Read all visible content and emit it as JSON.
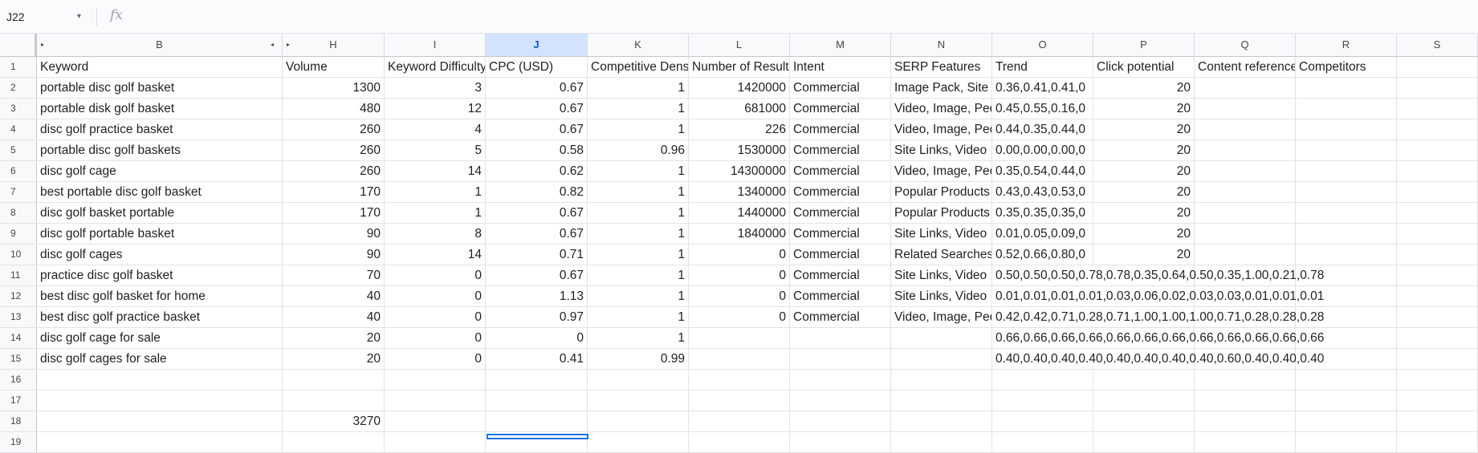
{
  "name_box": "J22",
  "name_box_arrow": "▾",
  "fx_label": "fx",
  "formula": "",
  "columns": [
    "B",
    "H",
    "I",
    "J",
    "K",
    "L",
    "M",
    "N",
    "O",
    "P",
    "Q",
    "R",
    "S"
  ],
  "selected_column": "J",
  "group_markers": {
    "left_b": "▸",
    "right_b": "◂",
    "left_h": "▸"
  },
  "rows": [
    {
      "n": "1",
      "cells": [
        "Keyword",
        "Volume",
        "Keyword Difficulty",
        "CPC (USD)",
        "Competitive Density",
        "Number of Results",
        "Intent",
        "SERP Features",
        "Trend",
        "Click potential",
        "Content references",
        "Competitors",
        ""
      ]
    },
    {
      "n": "2",
      "cells": [
        "portable disc golf basket",
        "1300",
        "3",
        "0.67",
        "1",
        "1420000",
        "Commercial",
        "Image Pack, Site Links",
        "0.36,0.41,0.41,0",
        "20",
        "",
        "",
        ""
      ]
    },
    {
      "n": "3",
      "cells": [
        "portable disk golf basket",
        "480",
        "12",
        "0.67",
        "1",
        "681000",
        "Commercial",
        "Video, Image, People",
        "0.45,0.55,0.16,0",
        "20",
        "",
        "",
        ""
      ]
    },
    {
      "n": "4",
      "cells": [
        "disc golf practice basket",
        "260",
        "4",
        "0.67",
        "1",
        "226",
        "Commercial",
        "Video, Image, People",
        "0.44,0.35,0.44,0",
        "20",
        "",
        "",
        ""
      ]
    },
    {
      "n": "5",
      "cells": [
        "portable disc golf baskets",
        "260",
        "5",
        "0.58",
        "0.96",
        "1530000",
        "Commercial",
        "Site Links, Video",
        "0.00,0.00,0.00,0",
        "20",
        "",
        "",
        ""
      ]
    },
    {
      "n": "6",
      "cells": [
        "disc golf cage",
        "260",
        "14",
        "0.62",
        "1",
        "14300000",
        "Commercial",
        "Video, Image, People",
        "0.35,0.54,0.44,0",
        "20",
        "",
        "",
        ""
      ]
    },
    {
      "n": "7",
      "cells": [
        "best portable disc golf basket",
        "170",
        "1",
        "0.82",
        "1",
        "1340000",
        "Commercial",
        "Popular Products",
        "0.43,0.43,0.53,0",
        "20",
        "",
        "",
        ""
      ]
    },
    {
      "n": "8",
      "cells": [
        "disc golf basket portable",
        "170",
        "1",
        "0.67",
        "1",
        "1440000",
        "Commercial",
        "Popular Products",
        "0.35,0.35,0.35,0",
        "20",
        "",
        "",
        ""
      ]
    },
    {
      "n": "9",
      "cells": [
        "disc golf portable basket",
        "90",
        "8",
        "0.67",
        "1",
        "1840000",
        "Commercial",
        "Site Links, Video",
        "0.01,0.05,0.09,0",
        "20",
        "",
        "",
        ""
      ]
    },
    {
      "n": "10",
      "cells": [
        "disc golf cages",
        "90",
        "14",
        "0.71",
        "1",
        "0",
        "Commercial",
        "Related Searches",
        "0.52,0.66,0.80,0",
        "20",
        "",
        "",
        ""
      ]
    },
    {
      "n": "11",
      "cells": [
        "practice disc golf basket",
        "70",
        "0",
        "0.67",
        "1",
        "0",
        "Commercial",
        "Site Links, Video",
        "0.50,0.50,0.50,0.78,0.78,0.35,0.64,0.50,0.35,1.00,0.21,0.78",
        "",
        "",
        "",
        ""
      ]
    },
    {
      "n": "12",
      "cells": [
        "best disc golf basket for home",
        "40",
        "0",
        "1.13",
        "1",
        "0",
        "Commercial",
        "Site Links, Video",
        "0.01,0.01,0.01,0.01,0.03,0.06,0.02,0.03,0.03,0.01,0.01,0.01",
        "",
        "",
        "",
        ""
      ]
    },
    {
      "n": "13",
      "cells": [
        "best disc golf practice basket",
        "40",
        "0",
        "0.97",
        "1",
        "0",
        "Commercial",
        "Video, Image, People",
        "0.42,0.42,0.71,0.28,0.71,1.00,1.00,1.00,0.71,0.28,0.28,0.28",
        "",
        "",
        "",
        ""
      ]
    },
    {
      "n": "14",
      "cells": [
        "disc golf cage for sale",
        "20",
        "0",
        "0",
        "1",
        "",
        "",
        "",
        "0.66,0.66,0.66,0.66,0.66,0.66,0.66,0.66,0.66,0.66,0.66,0.66",
        "",
        "",
        "",
        ""
      ]
    },
    {
      "n": "15",
      "cells": [
        "disc golf cages for sale",
        "20",
        "0",
        "0.41",
        "0.99",
        "",
        "",
        "",
        "0.40,0.40,0.40,0.40,0.40,0.40,0.40,0.40,0.60,0.40,0.40,0.40",
        "",
        "",
        "",
        ""
      ]
    },
    {
      "n": "16",
      "cells": [
        "",
        "",
        "",
        "",
        "",
        "",
        "",
        "",
        "",
        "",
        "",
        "",
        ""
      ]
    },
    {
      "n": "17",
      "cells": [
        "",
        "",
        "",
        "",
        "",
        "",
        "",
        "",
        "",
        "",
        "",
        "",
        ""
      ]
    },
    {
      "n": "18",
      "cells": [
        "",
        "3270",
        "",
        "",
        "",
        "",
        "",
        "",
        "",
        "",
        "",
        "",
        ""
      ]
    },
    {
      "n": "19",
      "cells": [
        "",
        "",
        "",
        "",
        "",
        "",
        "",
        "",
        "",
        "",
        "",
        "",
        ""
      ]
    }
  ]
}
